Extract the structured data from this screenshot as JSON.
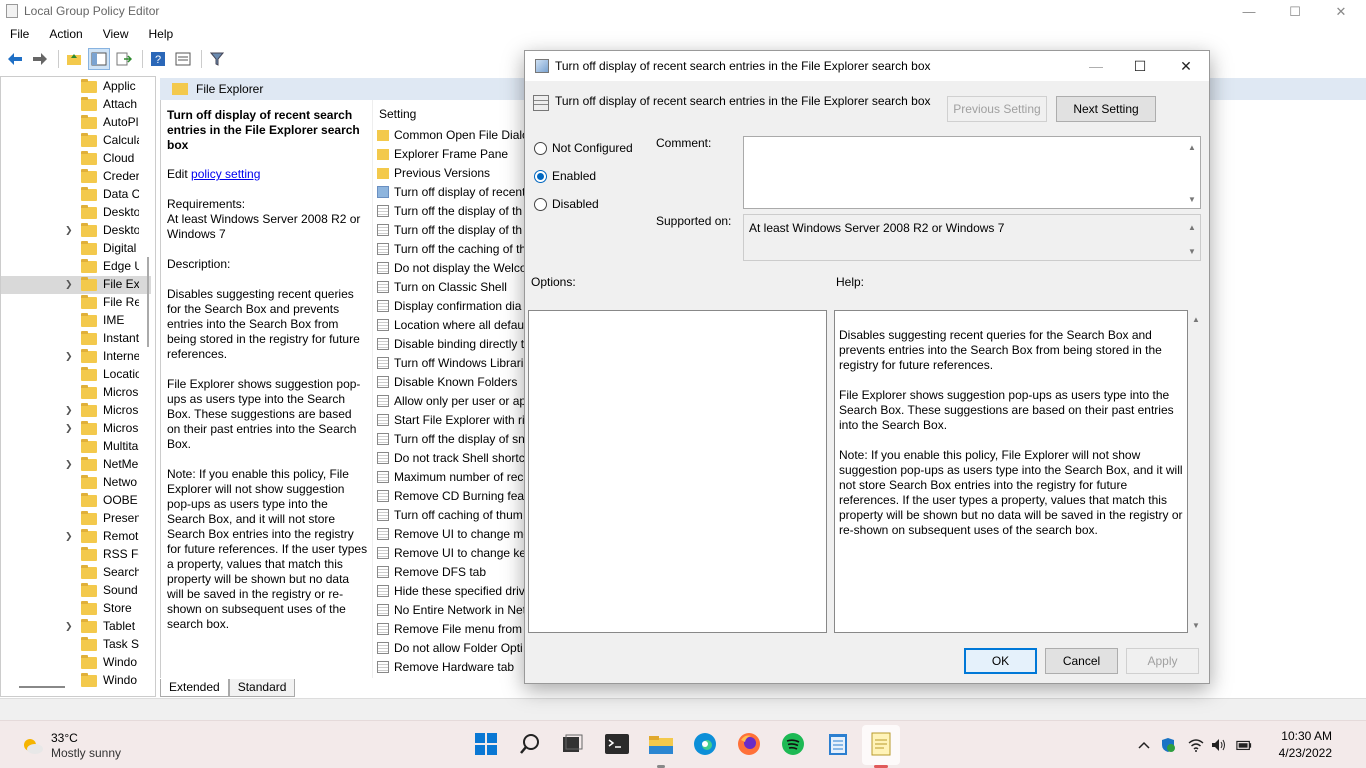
{
  "main_window": {
    "title": "Local Group Policy Editor",
    "menu": [
      "File",
      "Action",
      "View",
      "Help"
    ],
    "controls": {
      "minimize": "—",
      "maximize": "☐",
      "close": "✕"
    }
  },
  "tree": {
    "items": [
      {
        "label": "Applic",
        "expandable": false
      },
      {
        "label": "Attach",
        "expandable": false
      },
      {
        "label": "AutoPl",
        "expandable": false
      },
      {
        "label": "Calcula",
        "expandable": false
      },
      {
        "label": "Cloud",
        "expandable": false
      },
      {
        "label": "Creder",
        "expandable": false
      },
      {
        "label": "Data C",
        "expandable": false
      },
      {
        "label": "Deskto",
        "expandable": false
      },
      {
        "label": "Deskto",
        "expandable": true
      },
      {
        "label": "Digital",
        "expandable": false
      },
      {
        "label": "Edge U",
        "expandable": false
      },
      {
        "label": "File Exp",
        "expandable": true,
        "selected": true
      },
      {
        "label": "File Re",
        "expandable": false
      },
      {
        "label": "IME",
        "expandable": false
      },
      {
        "label": "Instant",
        "expandable": false
      },
      {
        "label": "Interne",
        "expandable": true
      },
      {
        "label": "Locatio",
        "expandable": false
      },
      {
        "label": "Micros",
        "expandable": false
      },
      {
        "label": "Micros",
        "expandable": true
      },
      {
        "label": "Micros",
        "expandable": true
      },
      {
        "label": "Multita",
        "expandable": false
      },
      {
        "label": "NetMe",
        "expandable": true
      },
      {
        "label": "Netwo",
        "expandable": false
      },
      {
        "label": "OOBE",
        "expandable": false
      },
      {
        "label": "Presen",
        "expandable": false
      },
      {
        "label": "Remot",
        "expandable": true
      },
      {
        "label": "RSS Fe",
        "expandable": false
      },
      {
        "label": "Search",
        "expandable": false
      },
      {
        "label": "Sound",
        "expandable": false
      },
      {
        "label": "Store",
        "expandable": false
      },
      {
        "label": "Tablet",
        "expandable": true
      },
      {
        "label": "Task Sc",
        "expandable": false
      },
      {
        "label": "Windo",
        "expandable": false
      },
      {
        "label": "Windo",
        "expandable": false
      }
    ]
  },
  "pane": {
    "header": "File Explorer",
    "desc_title": "Turn off display of recent search entries in the File Explorer search box",
    "edit_prefix": "Edit",
    "edit_link": "policy setting",
    "requirements_label": "Requirements:",
    "requirements": "At least Windows Server 2008 R2 or Windows 7",
    "description_label": "Description:",
    "desc_p1": "Disables suggesting recent queries for the Search Box and prevents entries into the Search Box from being stored in the registry for future references.",
    "desc_p2": "File Explorer shows suggestion pop-ups as users type into the Search Box.  These suggestions are based on their past entries into the Search Box.",
    "desc_p3": "Note: If you enable this policy, File Explorer will not show suggestion pop-ups as users type into the Search Box, and it will not store Search Box entries into the registry for future references.  If the user types a property, values that match this property will be shown but no data will be saved in the registry or re-shown on subsequent uses of the search box.",
    "settings_header": "Setting",
    "settings": [
      {
        "label": "Common Open File Dialo",
        "kind": "folder"
      },
      {
        "label": "Explorer Frame Pane",
        "kind": "folder"
      },
      {
        "label": "Previous Versions",
        "kind": "folder"
      },
      {
        "label": "Turn off display of recent",
        "kind": "active"
      },
      {
        "label": "Turn off the display of th",
        "kind": "setting"
      },
      {
        "label": "Turn off the display of th",
        "kind": "setting"
      },
      {
        "label": "Turn off the caching of th",
        "kind": "setting"
      },
      {
        "label": "Do not display the Welco",
        "kind": "setting"
      },
      {
        "label": "Turn on Classic Shell",
        "kind": "setting"
      },
      {
        "label": "Display confirmation dia",
        "kind": "setting"
      },
      {
        "label": "Location where all defau",
        "kind": "setting"
      },
      {
        "label": "Disable binding directly t",
        "kind": "setting"
      },
      {
        "label": "Turn off Windows Librari",
        "kind": "setting"
      },
      {
        "label": "Disable Known Folders",
        "kind": "setting"
      },
      {
        "label": "Allow only per user or ap",
        "kind": "setting"
      },
      {
        "label": "Start File Explorer with ri",
        "kind": "setting"
      },
      {
        "label": "Turn off the display of sn",
        "kind": "setting"
      },
      {
        "label": "Do not track Shell shortc",
        "kind": "setting"
      },
      {
        "label": "Maximum number of rec",
        "kind": "setting"
      },
      {
        "label": "Remove CD Burning feat",
        "kind": "setting"
      },
      {
        "label": "Turn off caching of thum",
        "kind": "setting"
      },
      {
        "label": "Remove UI to change me",
        "kind": "setting"
      },
      {
        "label": "Remove UI to change key",
        "kind": "setting"
      },
      {
        "label": "Remove DFS tab",
        "kind": "setting"
      },
      {
        "label": "Hide these specified driv",
        "kind": "setting"
      },
      {
        "label": "No Entire Network in Net",
        "kind": "setting"
      },
      {
        "label": "Remove File menu from",
        "kind": "setting"
      },
      {
        "label": "Do not allow Folder Opti",
        "kind": "setting"
      },
      {
        "label": "Remove Hardware tab",
        "kind": "setting"
      }
    ],
    "tabs": [
      "Extended",
      "Standard"
    ]
  },
  "dialog": {
    "title": "Turn off display of recent search entries in the File Explorer search box",
    "heading": "Turn off display of recent search entries in the File Explorer search box",
    "prev_label": "Previous Setting",
    "next_label": "Next Setting",
    "options": [
      {
        "label": "Not Configured",
        "checked": false
      },
      {
        "label": "Enabled",
        "checked": true
      },
      {
        "label": "Disabled",
        "checked": false
      }
    ],
    "comment_label": "Comment:",
    "comment_value": "",
    "supported_label": "Supported on:",
    "supported_value": "At least Windows Server 2008 R2 or Windows 7",
    "options_label": "Options:",
    "help_label": "Help:",
    "help_p1": "Disables suggesting recent queries for the Search Box and prevents entries into the Search Box from being stored in the registry for future references.",
    "help_p2": "File Explorer shows suggestion pop-ups as users type into the Search Box.  These suggestions are based on their past entries into the Search Box.",
    "help_p3": "Note: If you enable this policy, File Explorer will not show suggestion pop-ups as users type into the Search Box, and it will not store Search Box entries into the registry for future references.  If the user types a property, values that match this property will be shown but no data will be saved in the registry or re-shown on subsequent uses of the search box.",
    "ok_label": "OK",
    "cancel_label": "Cancel",
    "apply_label": "Apply"
  },
  "taskbar": {
    "weather_temp": "33°C",
    "weather_desc": "Mostly sunny",
    "time": "10:30 AM",
    "date": "4/23/2022"
  },
  "colors": {
    "accent": "#0067c0",
    "pane_header_bg": "#dfe8f3",
    "taskbar_bg": "#f3eaea",
    "folder": "#f3c94c"
  }
}
